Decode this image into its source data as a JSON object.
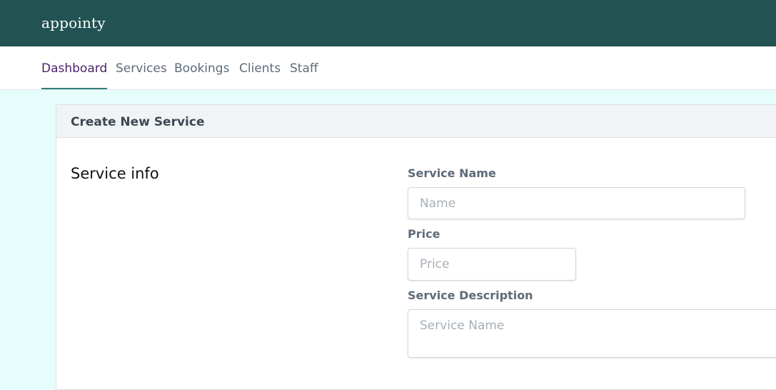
{
  "app": {
    "brand": "appointy"
  },
  "nav": {
    "items": [
      {
        "label": "Dashboard",
        "active": true
      },
      {
        "label": "Services",
        "active": false
      },
      {
        "label": "Bookings",
        "active": false
      },
      {
        "label": "Clients",
        "active": false
      },
      {
        "label": "Staff",
        "active": false
      }
    ]
  },
  "form": {
    "title": "Create New Service",
    "section_title": "Service info",
    "fields": {
      "name": {
        "label": "Service Name",
        "placeholder": "Name",
        "value": ""
      },
      "price": {
        "label": "Price",
        "placeholder": "Price",
        "value": ""
      },
      "description": {
        "label": "Service Description",
        "placeholder": "Service Name",
        "value": ""
      }
    }
  },
  "colors": {
    "header_bg": "#225252",
    "page_bg": "#e6fefb",
    "active_tab_text": "#4a1f68",
    "active_tab_underline": "#2f7f7a"
  }
}
